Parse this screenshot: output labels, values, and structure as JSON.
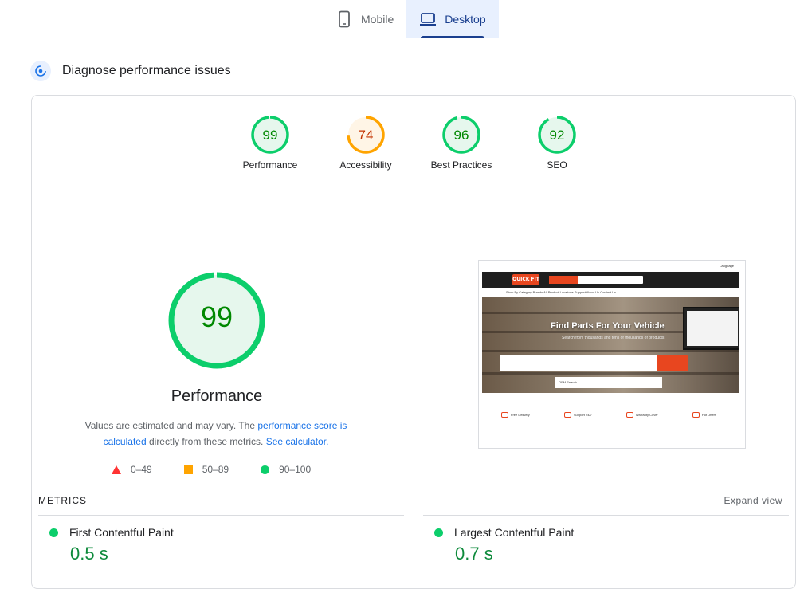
{
  "tabs": [
    {
      "label": "Mobile",
      "icon": "phone-icon",
      "active": false
    },
    {
      "label": "Desktop",
      "icon": "laptop-icon",
      "active": true
    }
  ],
  "diagnose": {
    "title": "Diagnose performance issues",
    "icon": "gauge-icon"
  },
  "scores": [
    {
      "label": "Performance",
      "value": "99",
      "score": 99,
      "status": "pass"
    },
    {
      "label": "Accessibility",
      "value": "74",
      "score": 74,
      "status": "average"
    },
    {
      "label": "Best Practices",
      "value": "96",
      "score": 96,
      "status": "pass"
    },
    {
      "label": "SEO",
      "value": "92",
      "score": 92,
      "status": "pass"
    }
  ],
  "main_score": {
    "value": "99",
    "score": 99,
    "label": "Performance"
  },
  "note": {
    "text1": "Values are estimated and may vary. The ",
    "link1": "performance score is calculated",
    "text2": " directly from these metrics. ",
    "link2": "See calculator."
  },
  "legend": [
    {
      "range": "0–49",
      "shape": "triangle",
      "color": "#ff3333"
    },
    {
      "range": "50–89",
      "shape": "square",
      "color": "#ffa400"
    },
    {
      "range": "90–100",
      "shape": "circle",
      "color": "#0cce6b"
    }
  ],
  "screenshot": {
    "topbar": [
      "Online Catalog",
      "Track Order",
      "Language"
    ],
    "logo": "QUICK FIT",
    "nav": "Shop By Category   Brands   All Product   Locations   Support   About Us   Contact Us",
    "hero_title": "Find Parts For Your Vehicle",
    "hero_sub": "Search from thousands and tens of thousands of products",
    "oem": "OEM Search",
    "features": [
      "Free Delivery",
      "Support 24/7",
      "Warranty Cover",
      "Hot Offers"
    ]
  },
  "metrics": {
    "title": "METRICS",
    "expand": "Expand view",
    "items": [
      {
        "label": "First Contentful Paint",
        "value": "0.5 s"
      },
      {
        "label": "Largest Contentful Paint",
        "value": "0.7 s"
      }
    ]
  },
  "colors": {
    "pass": "#0cce6b",
    "pass_text": "#008800",
    "average": "#ffa400",
    "average_text": "#c33300",
    "accent": "#1a73e8"
  }
}
